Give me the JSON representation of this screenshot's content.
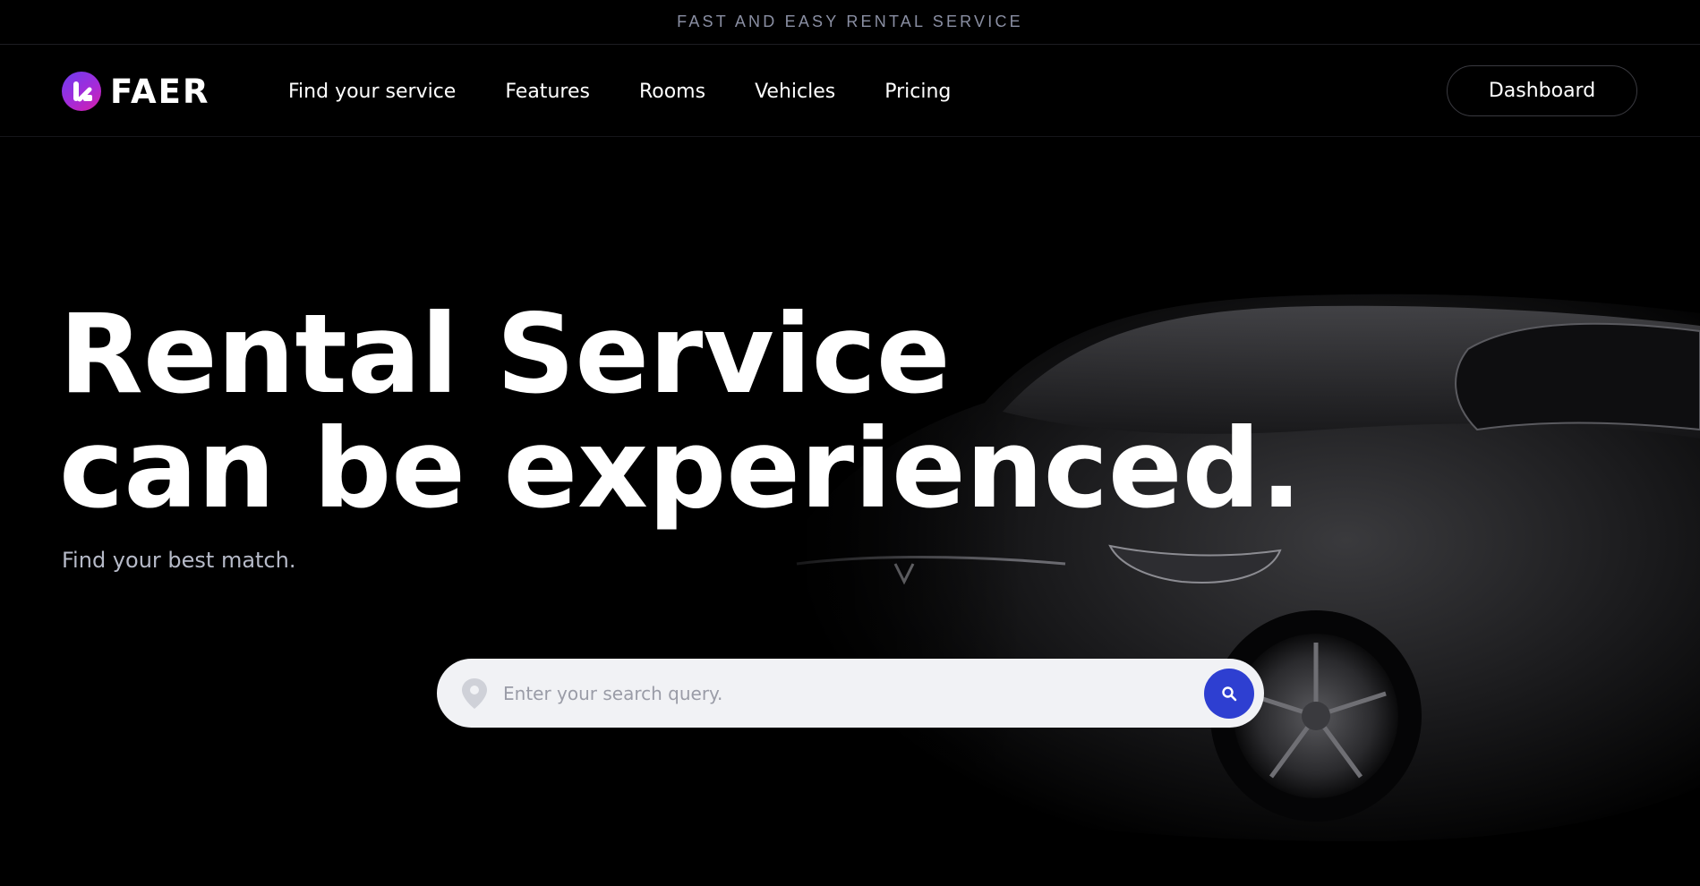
{
  "announcement": {
    "text": "FAST AND EASY RENTAL SERVICE"
  },
  "brand": {
    "name": "FAER",
    "logo_icon": "faer-logo-icon"
  },
  "nav": {
    "items": [
      {
        "label": "Find your service"
      },
      {
        "label": "Features"
      },
      {
        "label": "Rooms"
      },
      {
        "label": "Vehicles"
      },
      {
        "label": "Pricing"
      }
    ],
    "dashboard_label": "Dashboard"
  },
  "hero": {
    "title_line1": "Rental Service",
    "title_line2": "can be experienced.",
    "subtitle": "Find your best match."
  },
  "search": {
    "placeholder": "Enter your search query.",
    "location_icon": "location-pin-icon",
    "button_icon": "search-icon"
  },
  "colors": {
    "background": "#000000",
    "accent": "#2e3fd1",
    "logo_gradient_start": "#6d3df0",
    "logo_gradient_end": "#d81fa8",
    "announcement_text": "#8a8fa3",
    "subtitle_text": "#b6bac8"
  }
}
